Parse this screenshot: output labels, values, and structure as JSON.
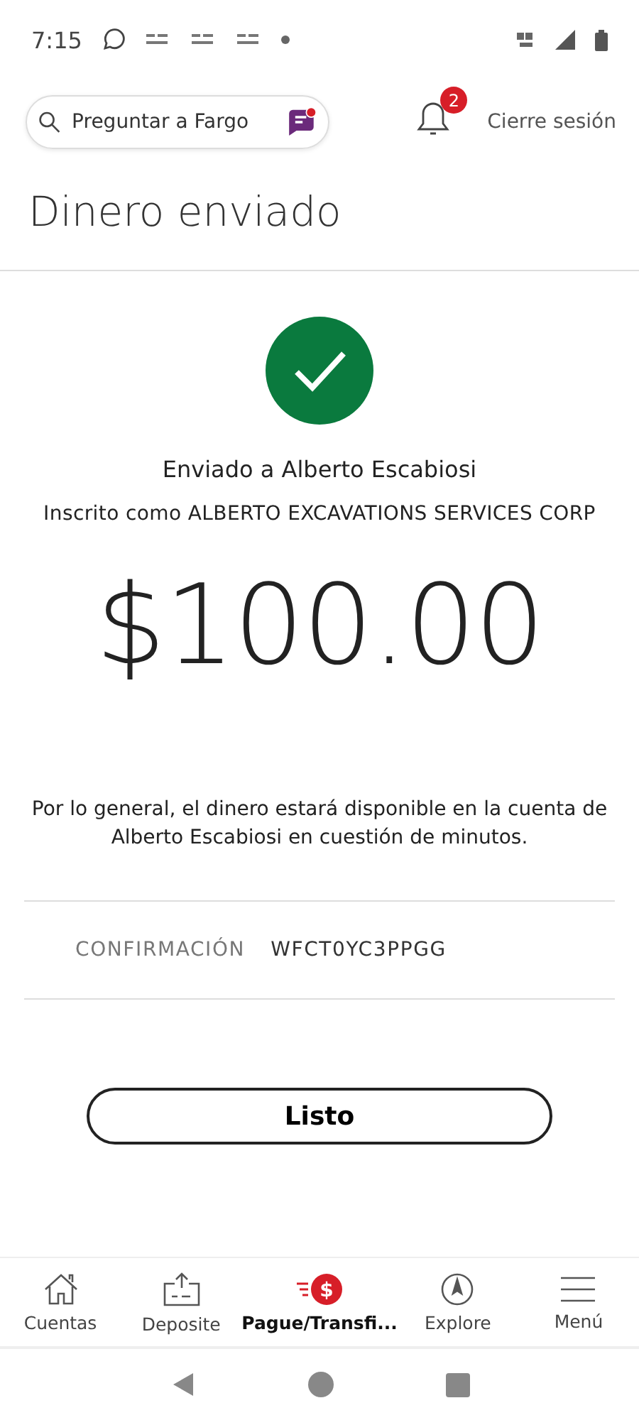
{
  "status_bar": {
    "time": "7:15"
  },
  "header": {
    "search": {
      "placeholder": "Preguntar a Fargo"
    },
    "notifications": {
      "count": "2"
    },
    "logout": "Cierre sesión"
  },
  "page_title": "Dinero enviado",
  "confirmation": {
    "sent_to": "Enviado a Alberto Escabiosi",
    "registered_as": "Inscrito como ALBERTO EXCAVATIONS SERVICES CORP",
    "amount": "$100.00",
    "note": "Por lo general, el dinero estará disponible en la cuenta de Alberto Escabiosi en cuestión de minutos.",
    "code_label": "CONFIRMACIÓN",
    "code": "WFCT0YC3PPGG"
  },
  "done_button": "Listo",
  "bottom_nav": [
    {
      "kind": "home",
      "label": "Cuentas",
      "selected": false
    },
    {
      "kind": "deposit",
      "label": "Deposite",
      "selected": false
    },
    {
      "kind": "pay",
      "badge": "$",
      "label": "Pague/Transfi...",
      "selected": true
    },
    {
      "kind": "explore",
      "label": "Explore",
      "selected": false
    },
    {
      "kind": "menu",
      "label": "Menú",
      "selected": false
    }
  ]
}
